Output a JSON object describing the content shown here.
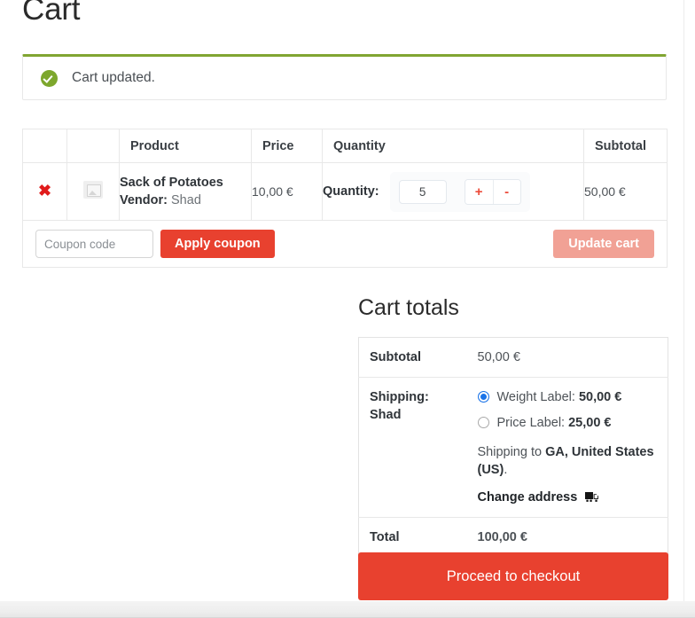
{
  "page": {
    "title": "Cart"
  },
  "notice": {
    "icon": "check-circle-icon",
    "message": "Cart updated."
  },
  "cart_table": {
    "headers": [
      "",
      "",
      "Product",
      "Price",
      "Quantity",
      "Subtotal"
    ],
    "rows": [
      {
        "remove_label": "✖",
        "thumbnail": "product-image-placeholder",
        "product_name": "Sack of Potatoes",
        "vendor_label": "Vendor:",
        "vendor_name": "Shad",
        "price": "10,00 €",
        "quantity_label": "Quantity:",
        "quantity_value": "5",
        "increase_label": "+",
        "decrease_label": "-",
        "subtotal": "50,00 €"
      }
    ]
  },
  "actions": {
    "coupon_placeholder": "Coupon code",
    "coupon_value": "",
    "apply_label": "Apply coupon",
    "update_label": "Update cart",
    "update_disabled": true
  },
  "totals": {
    "heading": "Cart totals",
    "subtotal_label": "Subtotal",
    "subtotal_value": "50,00 €",
    "shipping_label": "Shipping:",
    "shipping_vendor": "Shad",
    "shipping_options": [
      {
        "name": "Weight Label:",
        "price": "50,00 €",
        "selected": true
      },
      {
        "name": "Price Label:",
        "price": "25,00 €",
        "selected": false
      }
    ],
    "shipping_to_prefix": "Shipping to",
    "shipping_to_destination": "GA, United States (US)",
    "shipping_to_suffix": ".",
    "change_address_label": "Change address",
    "change_address_icon": "delivery-truck-icon",
    "total_label": "Total",
    "total_value": "100,00 €"
  },
  "checkout": {
    "label": "Proceed to checkout"
  },
  "colors": {
    "brand_red": "#e8412f",
    "brand_red_disabled": "#f1a195",
    "notice_green": "#81a532",
    "radio_blue": "#1a73e8",
    "remove_red": "#e01b1b"
  }
}
